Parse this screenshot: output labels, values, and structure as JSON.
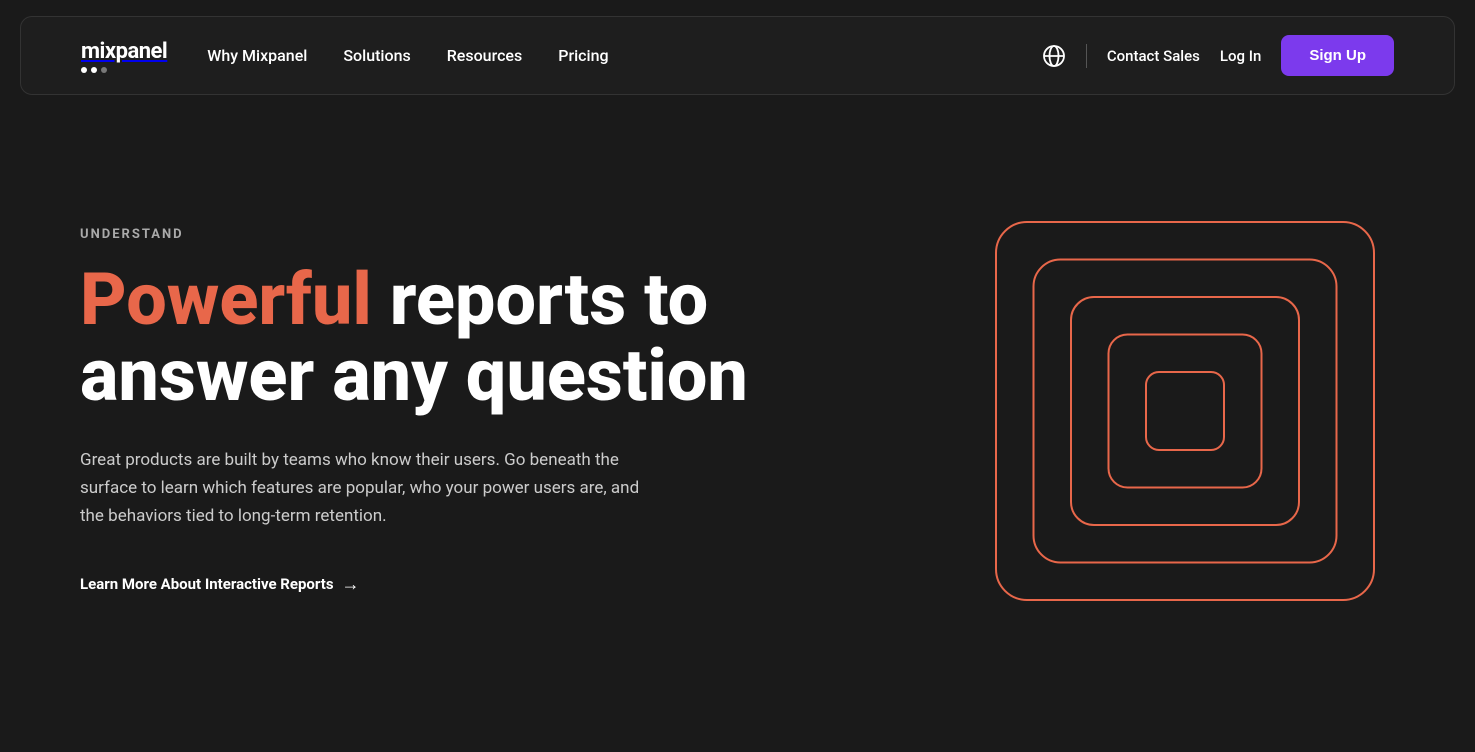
{
  "nav": {
    "logo": "mixpanel",
    "links": [
      {
        "label": "Why Mixpanel",
        "id": "why-mixpanel"
      },
      {
        "label": "Solutions",
        "id": "solutions"
      },
      {
        "label": "Resources",
        "id": "resources"
      },
      {
        "label": "Pricing",
        "id": "pricing"
      }
    ],
    "contact_sales": "Contact Sales",
    "log_in": "Log In",
    "sign_up": "Sign Up"
  },
  "hero": {
    "eyebrow": "UNDERSTAND",
    "heading_highlight": "Powerful",
    "heading_rest": " reports to answer any question",
    "description": "Great products are built by teams who know their users. Go beneath the surface to learn which features are popular, who your power users are, and the behaviors tied to long-term retention.",
    "cta": "Learn More About Interactive Reports",
    "cta_arrow": "→"
  }
}
